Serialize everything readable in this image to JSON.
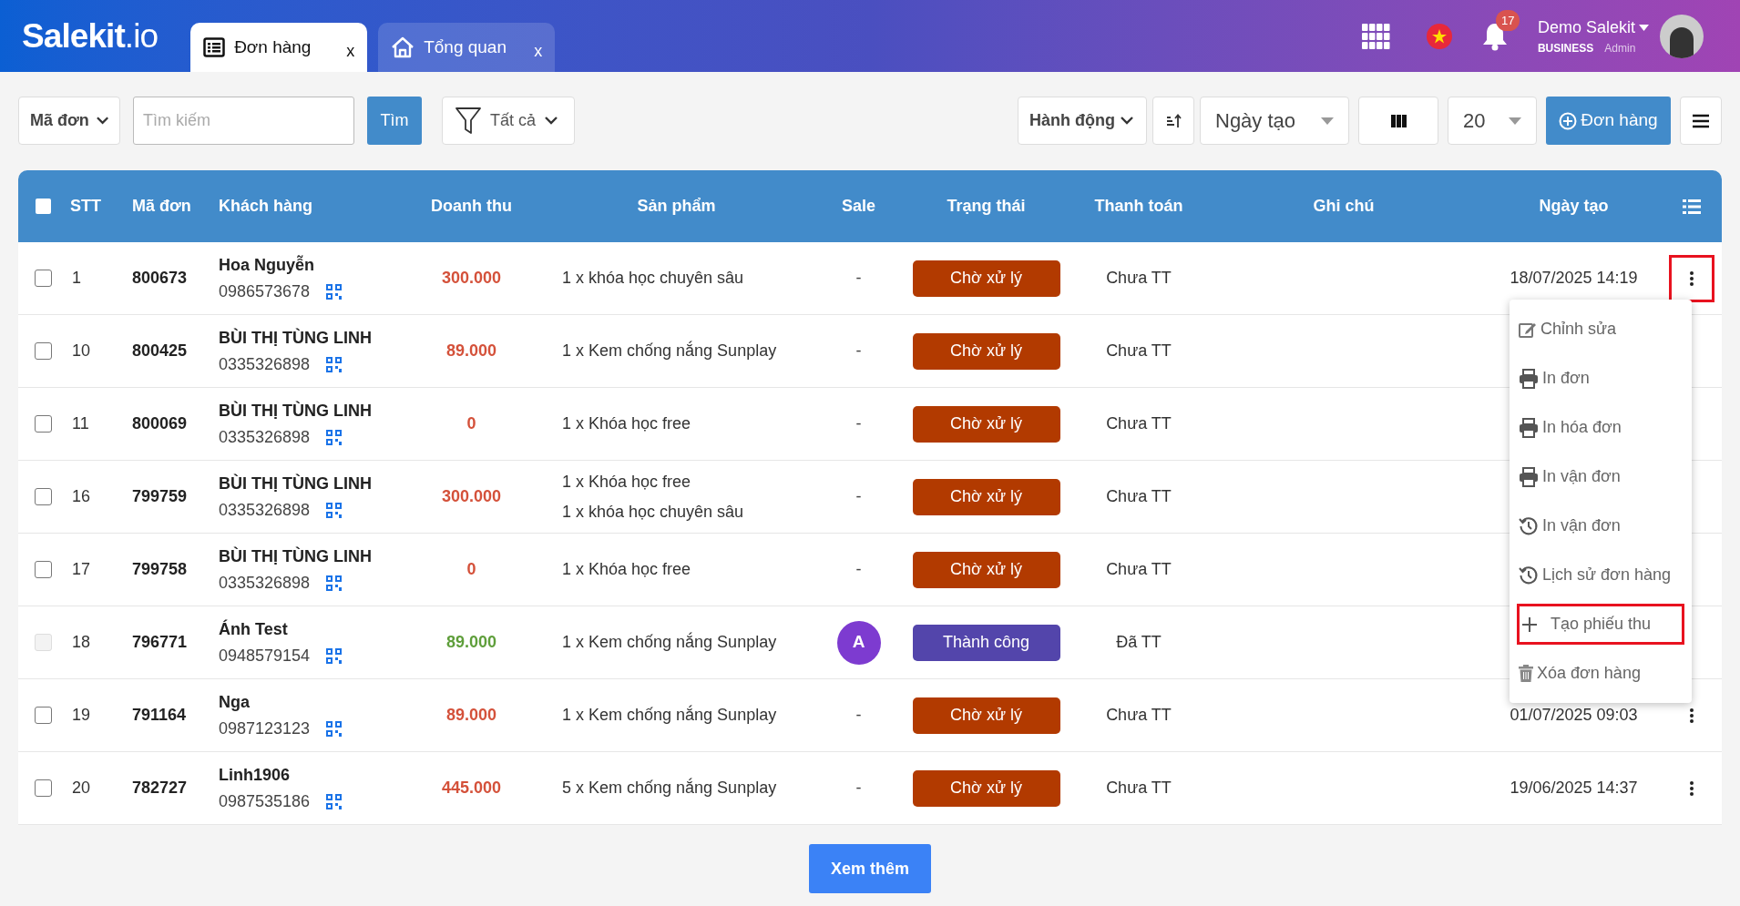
{
  "header": {
    "logo": "**Salekit**.io",
    "tabs": [
      {
        "label": "Đơn hàng",
        "close": "x",
        "selected": true
      },
      {
        "label": "Tổng quan",
        "close": "x",
        "selected": false
      }
    ],
    "notifications": "17",
    "user": {
      "name": "Demo Salekit",
      "plan": "BUSINESS",
      "role": "Admin"
    }
  },
  "toolbar": {
    "field_select": "Mã đơn",
    "search": {
      "placeholder": "Tìm kiếm"
    },
    "search_button": "Tìm",
    "filter": "Tất cả",
    "action_select": "Hành động",
    "sort_select": "Ngày tạo",
    "page_size": "20",
    "add_button": "Đơn hàng"
  },
  "table": {
    "select_all_checked": false,
    "columns": [
      "STT",
      "Mã đơn",
      "Khách hàng",
      "Doanh thu",
      "Sản phẩm",
      "Sale",
      "Trạng thái",
      "Thanh toán",
      "Ghi chú",
      "Ngày tạo"
    ],
    "rows": [
      {
        "stt": "1",
        "code": "800673",
        "customer": "Hoa Nguyễn",
        "phone": "0986573678",
        "revenue": "300.000",
        "products": [
          "1 x khóa học chuyên sâu"
        ],
        "sale": {
          "kind": "text",
          "text": "-"
        },
        "status": {
          "kind": "pending",
          "label": "Chờ xử lý"
        },
        "payment": "Chưa TT",
        "date": "18/07/2025 14:19",
        "checked": false,
        "disabled": false,
        "highlighted": true
      },
      {
        "stt": "10",
        "code": "800425",
        "customer": "BÙI THỊ TÙNG LINH",
        "phone": "0335326898",
        "revenue": "89.000",
        "products": [
          "1 x Kem chống nắng Sunplay"
        ],
        "sale": {
          "kind": "text",
          "text": "-"
        },
        "status": {
          "kind": "pending",
          "label": "Chờ xử lý"
        },
        "payment": "Chưa TT",
        "checked": false,
        "disabled": false
      },
      {
        "stt": "11",
        "code": "800069",
        "customer": "BÙI THỊ TÙNG LINH",
        "phone": "0335326898",
        "revenue": "0",
        "products": [
          "1 x Khóa học free"
        ],
        "sale": {
          "kind": "text",
          "text": "-"
        },
        "status": {
          "kind": "pending",
          "label": "Chờ xử lý"
        },
        "payment": "Chưa TT",
        "checked": false,
        "disabled": false
      },
      {
        "stt": "16",
        "code": "799759",
        "customer": "BÙI THỊ TÙNG LINH",
        "phone": "0335326898",
        "revenue": "300.000",
        "products": [
          "1 x Khóa học free",
          "1 x khóa học chuyên sâu"
        ],
        "sale": {
          "kind": "text",
          "text": "-"
        },
        "status": {
          "kind": "pending",
          "label": "Chờ xử lý"
        },
        "payment": "Chưa TT",
        "checked": false,
        "disabled": false
      },
      {
        "stt": "17",
        "code": "799758",
        "customer": "BÙI THỊ TÙNG LINH",
        "phone": "0335326898",
        "revenue": "0",
        "products": [
          "1 x Khóa học free"
        ],
        "sale": {
          "kind": "text",
          "text": "-"
        },
        "status": {
          "kind": "pending",
          "label": "Chờ xử lý"
        },
        "payment": "Chưa TT",
        "checked": false,
        "disabled": false
      },
      {
        "stt": "18",
        "code": "796771",
        "customer": "Ánh Test",
        "phone": "0948579154",
        "revenue": "89.000",
        "products": [
          "1 x Kem chống nắng Sunplay"
        ],
        "sale": {
          "kind": "avatar",
          "text": "A"
        },
        "status": {
          "kind": "success",
          "label": "Thành công"
        },
        "payment": "Đã TT",
        "checked": false,
        "disabled": true
      },
      {
        "stt": "19",
        "code": "791164",
        "customer": "Nga",
        "phone": "0987123123",
        "revenue": "89.000",
        "products": [
          "1 x Kem chống nắng Sunplay"
        ],
        "sale": {
          "kind": "text",
          "text": "-"
        },
        "status": {
          "kind": "pending",
          "label": "Chờ xử lý"
        },
        "payment": "Chưa TT",
        "date": "01/07/2025 09:03",
        "checked": false,
        "disabled": false,
        "highlighted": false
      },
      {
        "stt": "20",
        "code": "782727",
        "customer": "Linh1906",
        "phone": "0987535186",
        "revenue": "445.000",
        "products": [
          "5 x Kem chống nắng Sunplay"
        ],
        "sale": {
          "kind": "text",
          "text": "-"
        },
        "status": {
          "kind": "pending",
          "label": "Chờ xử lý"
        },
        "payment": "Chưa TT",
        "date": "19/06/2025 14:37",
        "checked": false,
        "disabled": false,
        "highlighted": false
      }
    ]
  },
  "row_menu": [
    {
      "kind": "edit",
      "label": "Chỉnh sửa",
      "highlighted": false
    },
    {
      "kind": "print",
      "label": "In đơn",
      "highlighted": false
    },
    {
      "kind": "print",
      "label": "In hóa đơn",
      "highlighted": false
    },
    {
      "kind": "print",
      "label": "In vận đơn",
      "highlighted": false
    },
    {
      "kind": "history",
      "label": "In vận đơn",
      "highlighted": false
    },
    {
      "kind": "history",
      "label": "Lịch sử đơn hàng",
      "highlighted": false
    },
    {
      "kind": "add",
      "label": "Tạo phiếu thu",
      "highlighted": true
    },
    {
      "kind": "delete",
      "label": "Xóa đơn hàng",
      "highlighted": false
    }
  ],
  "load_more": "Xem thêm"
}
